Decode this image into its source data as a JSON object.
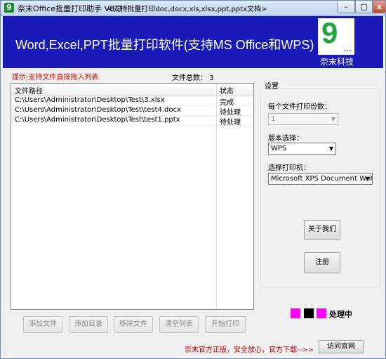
{
  "window": {
    "title": "奈末Office批量打印助手 V8.3",
    "subtitle": "<支持批量打印doc,docx,xls,xlsx,ppt,pptx文档>",
    "min_glyph": "–",
    "max_glyph": "□",
    "close_glyph": "x",
    "icon_glyph": "9"
  },
  "banner": {
    "title": "Word,Excel,PPT批量打印软件(支持MS Office和WPS)",
    "logo_number": "9",
    "logo_dots": "...",
    "company": "奈末科技",
    "background": "#1a1ab9"
  },
  "tip": "提示:支持文件直接拖入列表",
  "file_count": {
    "label": "文件总数：",
    "value": "3"
  },
  "file_list": {
    "columns": [
      "文件路径",
      "状态"
    ],
    "rows": [
      {
        "path": "C:\\Users\\Administrator\\Desktop\\Test\\3.xlsx",
        "status": "完成"
      },
      {
        "path": "C:\\Users\\Administrator\\Desktop\\Test\\test4.docx",
        "status": "待处理"
      },
      {
        "path": "C:\\Users\\Administrator\\Desktop\\Test\\test1.pptx",
        "status": "待处理"
      }
    ]
  },
  "bottom_buttons": [
    "添加文件",
    "添加目录",
    "移除文件",
    "清空列表",
    "开始打印"
  ],
  "settings": {
    "title": "设置",
    "copies_label": "每个文件打印份数：",
    "copies_value": "1",
    "version_label": "版本选择：",
    "version_value": "WPS",
    "printer_label": "选择打印机：",
    "printer_value": "Microsoft XPS Document Writer"
  },
  "about_button": "关于我们",
  "register_button": "注册",
  "status": {
    "text": "处理中",
    "colors": [
      "#ff00ff",
      "#000000",
      "#ff00ff"
    ]
  },
  "footer": {
    "text": "奈末官方正版，安全放心，官方下载-->>",
    "visit_button": "访问官网"
  }
}
